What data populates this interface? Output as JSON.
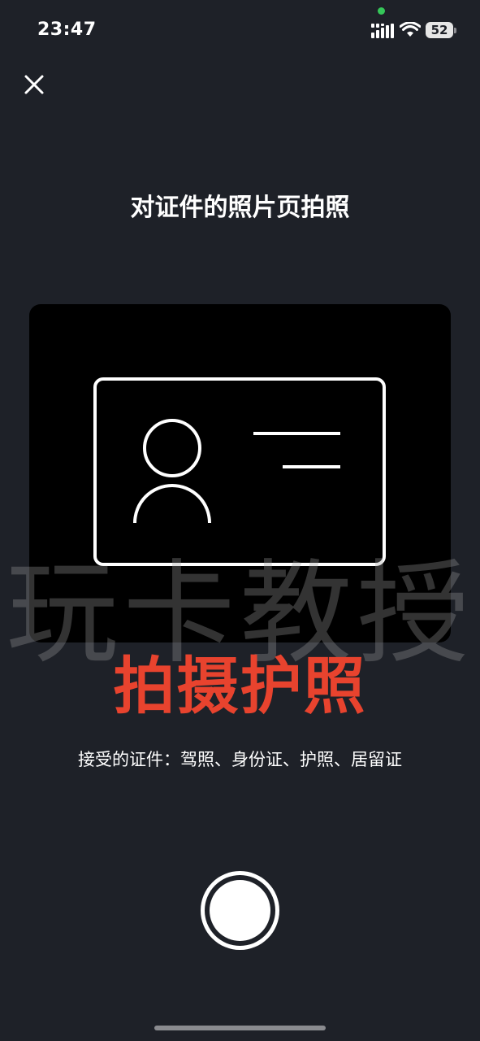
{
  "status_bar": {
    "time": "23:47",
    "battery_level": "52",
    "colors": {
      "privacy_indicator": "#35c759"
    },
    "icons": [
      "signal-icon",
      "wifi-icon",
      "battery-icon"
    ]
  },
  "header": {
    "close_icon": "close-icon",
    "title": "对证件的照片页拍照"
  },
  "preview": {
    "illustration_icon": "id-card-icon",
    "watermark": "玩卡教授",
    "overlay_label": "拍摄护照",
    "overlay_color": "#e8432e"
  },
  "footer": {
    "accepted_documents": "接受的证件：驾照、身份证、护照、居留证",
    "shutter_icon": "shutter-icon"
  },
  "theme": {
    "background": "#1e2128",
    "preview_background": "#000000"
  }
}
